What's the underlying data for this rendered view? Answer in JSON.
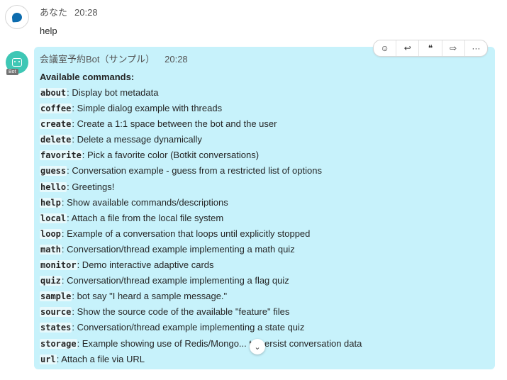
{
  "user_message": {
    "sender": "あなた",
    "time": "20:28",
    "text": "help",
    "avatar_icon": "chat-bubble-icon"
  },
  "bot_message": {
    "sender": "会議室予約Bot（サンプル）",
    "time": "20:28",
    "badge": "Bot",
    "avatar_icon": "bot-icon",
    "title": "Available commands:",
    "commands": [
      {
        "name": "about",
        "desc": ": Display bot metadata"
      },
      {
        "name": "coffee",
        "desc": ": Simple dialog example with threads"
      },
      {
        "name": "create",
        "desc": ": Create a 1:1 space between the bot and the user"
      },
      {
        "name": "delete",
        "desc": ": Delete a message dynamically"
      },
      {
        "name": "favorite",
        "desc": ": Pick a favorite color (Botkit conversations)"
      },
      {
        "name": "guess",
        "desc": ": Conversation example - guess from a restricted list of options"
      },
      {
        "name": "hello",
        "desc": ": Greetings!"
      },
      {
        "name": "help",
        "desc": ": Show available commands/descriptions"
      },
      {
        "name": "local",
        "desc": ": Attach a file from the local file system"
      },
      {
        "name": "loop",
        "desc": ": Example of a conversation that loops until explicitly stopped"
      },
      {
        "name": "math",
        "desc": ": Conversation/thread example implementing a math quiz"
      },
      {
        "name": "monitor",
        "desc": ": Demo interactive adaptive cards"
      },
      {
        "name": "quiz",
        "desc": ": Conversation/thread example implementing a flag quiz"
      },
      {
        "name": "sample",
        "desc": ": bot say \"I heard a sample message.\""
      },
      {
        "name": "source",
        "desc": ": Show the source code of the available \"feature\" files"
      },
      {
        "name": "states",
        "desc": ": Conversation/thread example implementing a state quiz"
      },
      {
        "name": "storage",
        "desc": ": Example showing use of Redis/Mongo... to persist conversation data"
      },
      {
        "name": "url",
        "desc": ": Attach a file via URL"
      }
    ]
  },
  "toolbar": {
    "react": "☺",
    "reply": "↩",
    "quote": "❝",
    "forward": "⇨",
    "more": "···"
  },
  "scroll_down": "⌄",
  "colors": {
    "bot_card": "#c7f2fb",
    "bot_avatar": "#3ec7b5",
    "user_avatar": "#0d6cae"
  }
}
